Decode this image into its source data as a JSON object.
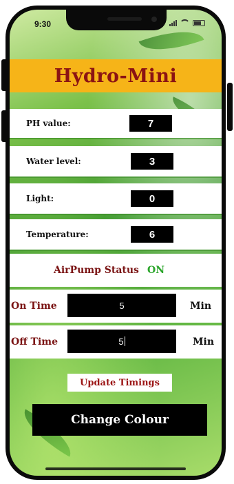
{
  "status_bar": {
    "time": "9:30"
  },
  "header": {
    "title": "Hydro-Mini"
  },
  "readings": [
    {
      "label": "PH value:",
      "value": "7"
    },
    {
      "label": "Water level:",
      "value": "3"
    },
    {
      "label": "Light:",
      "value": "0"
    },
    {
      "label": "Temperature:",
      "value": "6"
    }
  ],
  "air_pump": {
    "label": "AirPump Status",
    "state": "ON"
  },
  "timings": {
    "on": {
      "label": "On Time",
      "value": "5",
      "unit": "Min"
    },
    "off": {
      "label": "Off Time",
      "value": "5",
      "unit": "Min"
    }
  },
  "buttons": {
    "update": "Update Timings",
    "change_colour": "Change Colour"
  },
  "colors": {
    "header_bg": "#f6b418",
    "title": "#8b1313",
    "pump_on": "#2aa52a",
    "accent_text": "#7b1515"
  }
}
